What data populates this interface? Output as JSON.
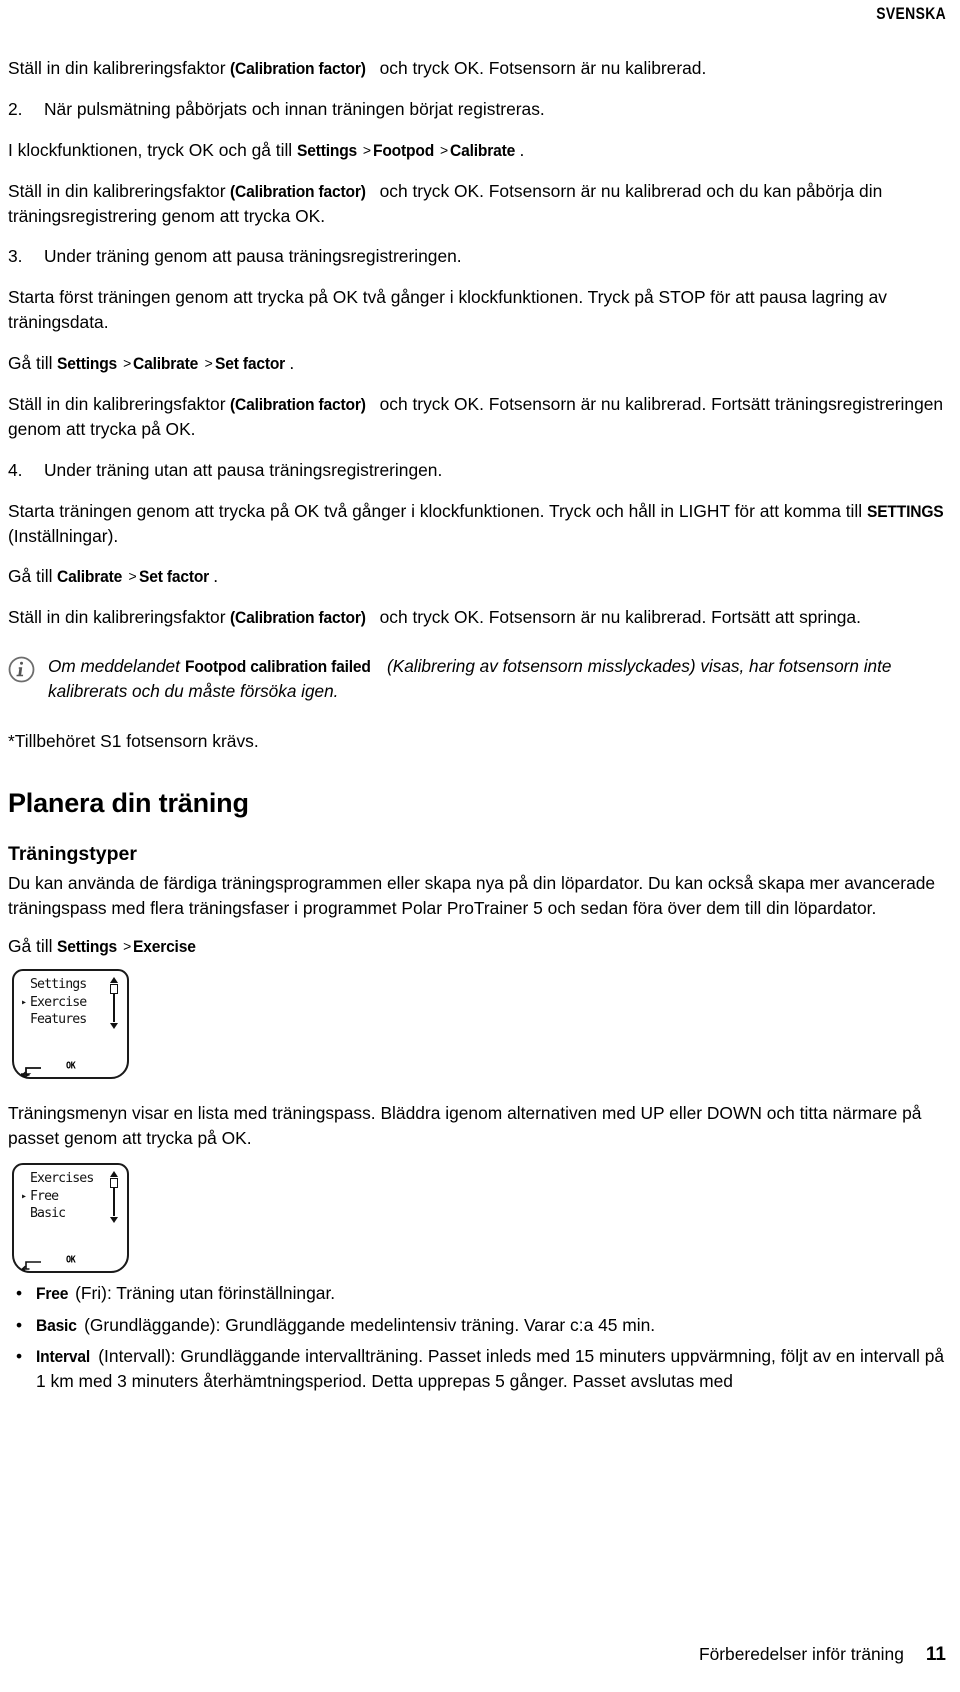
{
  "header": {
    "language_label": "SVENSKA"
  },
  "intro": {
    "para1_before": "Ställ in din kalibreringsfaktor ",
    "para1_mono": "(Calibration factor)",
    "para1_after": " och tryck OK. Fotsensorn är nu kalibrerad."
  },
  "steps": [
    {
      "number": "2.",
      "title": "När pulsmätning påbörjats och innan träningen börjat registreras.",
      "nav_prefix": "I klockfunktionen, tryck OK och gå till ",
      "nav_items": [
        "Settings",
        "Footpod",
        "Calibrate"
      ],
      "nav_suffix": ".",
      "body_before": "Ställ in din kalibreringsfaktor ",
      "body_mono": "(Calibration factor)",
      "body_after": " och tryck OK. Fotsensorn är nu kalibrerad och du kan påbörja din träningsregistrering genom att trycka OK."
    },
    {
      "number": "3.",
      "title": "Under träning genom att pausa träningsregistreringen.",
      "lead": "Starta först träningen genom att trycka på OK två gånger i klockfunktionen. Tryck på STOP för att pausa lagring av träningsdata.",
      "nav_prefix": "Gå till ",
      "nav_items": [
        "Settings",
        "Calibrate",
        "Set factor"
      ],
      "nav_suffix": ".",
      "body_before": "Ställ in din kalibreringsfaktor ",
      "body_mono": "(Calibration factor)",
      "body_after": " och tryck OK. Fotsensorn är nu kalibrerad. Fortsätt träningsregistreringen genom att trycka på OK."
    },
    {
      "number": "4.",
      "title": "Under träning utan att pausa träningsregistreringen.",
      "lead_before": "Starta träningen genom att trycka på OK två gånger i klockfunktionen. Tryck och håll in LIGHT för att komma till ",
      "lead_mono": "SETTINGS",
      "lead_after": " (Inställningar).",
      "nav_prefix": "Gå till ",
      "nav_items": [
        "Calibrate",
        "Set factor"
      ],
      "nav_suffix": ".",
      "body_before": "Ställ in din kalibreringsfaktor ",
      "body_mono": "(Calibration factor)",
      "body_after": " och tryck OK. Fotsensorn är nu kalibrerad. Fortsätt att springa."
    }
  ],
  "note": {
    "icon": "info-icon",
    "text_before": "Om meddelandet ",
    "text_mono": "Footpod calibration failed",
    "text_after": " (Kalibrering av fotsensorn misslyckades) visas, har fotsensorn inte kalibrerats och du måste försöka igen."
  },
  "footnote": "*Tillbehöret S1 fotsensorn krävs.",
  "planning": {
    "heading": "Planera din träning",
    "subheading": "Träningstyper",
    "paragraph": "Du kan använda de färdiga träningsprogrammen eller skapa nya på din löpardator. Du kan också skapa mer avancerade träningspass med flera träningsfaser i programmet Polar ProTrainer 5 och sedan föra över dem till din löpardator.",
    "nav_prefix": "Gå till ",
    "nav_items": [
      "Settings",
      "Exercise"
    ]
  },
  "watch_screen_1": {
    "lines": [
      {
        "marker": "",
        "text": "Settings"
      },
      {
        "marker": "▸",
        "text": "Exercise"
      },
      {
        "marker": "",
        "text": "Features"
      }
    ],
    "back_button": "back-arrow",
    "ok_label": "OK"
  },
  "menu_description": "Träningsmenyn visar en lista med träningspass. Bläddra igenom alternativen med UP eller DOWN och titta närmare på passet genom att trycka på OK.",
  "watch_screen_2": {
    "lines": [
      {
        "marker": "",
        "text": "Exercises"
      },
      {
        "marker": "▸",
        "text": "Free"
      },
      {
        "marker": "",
        "text": "Basic"
      }
    ],
    "back_button": "back-arrow",
    "ok_label": "OK"
  },
  "exercise_types": [
    {
      "name": "Free",
      "description": " (Fri): Träning utan förinställningar."
    },
    {
      "name": "Basic",
      "description": " (Grundläggande): Grundläggande medelintensiv träning. Varar c:a 45 min."
    },
    {
      "name": "Interval",
      "description": " (Intervall): Grundläggande intervallträning. Passet inleds med 15 minuters uppvärmning, följt av en intervall på 1 km med 3 minuters återhämtningsperiod. Detta upprepas 5 gånger. Passet avslutas med"
    }
  ],
  "footer": {
    "section_title": "Förberedelser inför träning",
    "page_number": "11"
  }
}
